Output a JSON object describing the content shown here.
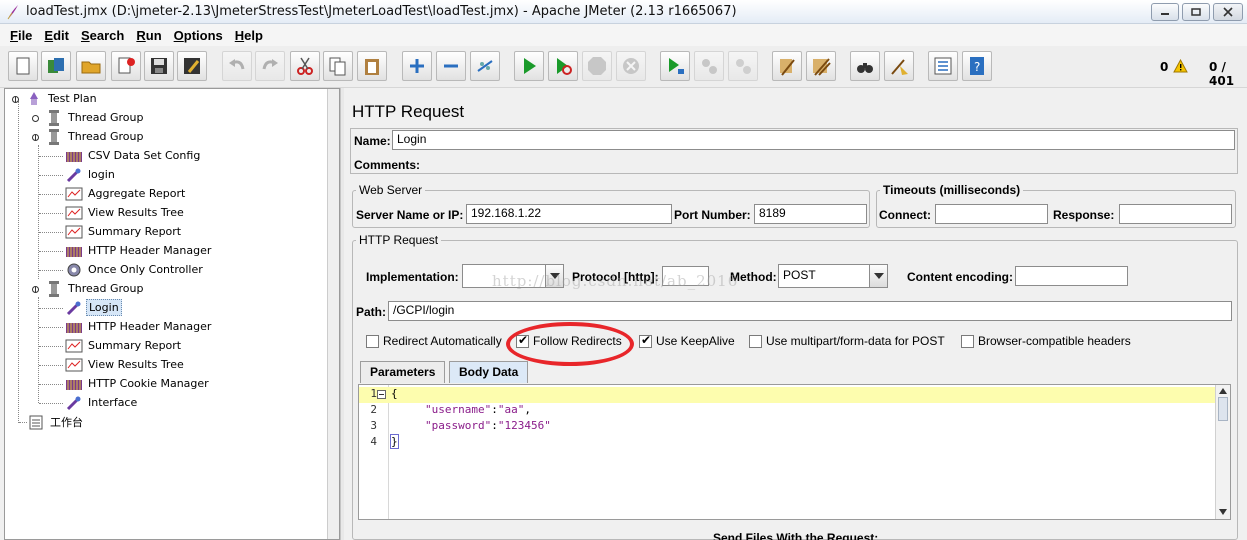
{
  "window": {
    "title": "loadTest.jmx (D:\\jmeter-2.13\\JmeterStressTest\\JmeterLoadTest\\loadTest.jmx) - Apache JMeter (2.13 r1665067)"
  },
  "menu": [
    {
      "label": "File",
      "mnemonic": "F",
      "rest": "ile"
    },
    {
      "label": "Edit",
      "mnemonic": "E",
      "rest": "dit"
    },
    {
      "label": "Search",
      "mnemonic": "S",
      "rest": "earch"
    },
    {
      "label": "Run",
      "mnemonic": "R",
      "rest": "un"
    },
    {
      "label": "Options",
      "mnemonic": "O",
      "rest": "ptions"
    },
    {
      "label": "Help",
      "mnemonic": "H",
      "rest": "elp"
    }
  ],
  "toolbar_status": {
    "error_count": "0",
    "threads": "0 / 401"
  },
  "tree": {
    "root": "Test Plan",
    "items": [
      "Thread Group",
      "Thread Group",
      "CSV Data Set Config",
      "login",
      "Aggregate Report",
      "View Results Tree",
      "Summary Report",
      "HTTP Header Manager",
      "Once Only Controller",
      "Thread Group",
      "Login",
      "HTTP Header Manager",
      "Summary Report",
      "View Results Tree",
      "HTTP Cookie Manager",
      "Interface",
      "工作台"
    ]
  },
  "panel": {
    "title": "HTTP Request",
    "name_label": "Name:",
    "name_value": "Login",
    "comments_label": "Comments:",
    "web_server": {
      "title": "Web Server",
      "server_label": "Server Name or IP:",
      "server_value": "192.168.1.22",
      "port_label": "Port Number:",
      "port_value": "8189"
    },
    "timeouts": {
      "title": "Timeouts (milliseconds)",
      "connect_label": "Connect:",
      "connect_value": "",
      "response_label": "Response:",
      "response_value": ""
    },
    "http_request": {
      "title": "HTTP Request",
      "implementation_label": "Implementation:",
      "implementation_value": "",
      "protocol_label": "Protocol [http]:",
      "protocol_value": "",
      "method_label": "Method:",
      "method_value": "POST",
      "encoding_label": "Content encoding:",
      "encoding_value": "",
      "path_label": "Path:",
      "path_value": "/GCPI/login"
    },
    "options": [
      {
        "label": "Redirect Automatically",
        "checked": false
      },
      {
        "label": "Follow Redirects",
        "checked": true
      },
      {
        "label": "Use KeepAlive",
        "checked": true
      },
      {
        "label": "Use multipart/form-data for POST",
        "checked": false
      },
      {
        "label": "Browser-compatible headers",
        "checked": false
      }
    ],
    "tabs": [
      "Parameters",
      "Body Data"
    ],
    "active_tab": "Body Data",
    "body_lines": [
      {
        "num": "1",
        "text": "{"
      },
      {
        "num": "2",
        "key": "\"username\"",
        "value": "\"aa\"",
        "suffix": ","
      },
      {
        "num": "3",
        "key": "\"password\"",
        "value": "\"123456\"",
        "suffix": ""
      },
      {
        "num": "4",
        "text": "}"
      }
    ],
    "send_files_label": "Send Files With the Request:"
  },
  "watermark": "http://blog.csdn.net/ab_2016",
  "colors": {
    "highlight_ring": "#e8262a",
    "current_line": "#fdfdae",
    "selection": "#d6e6f7",
    "active_tab": "#dce9f7"
  }
}
